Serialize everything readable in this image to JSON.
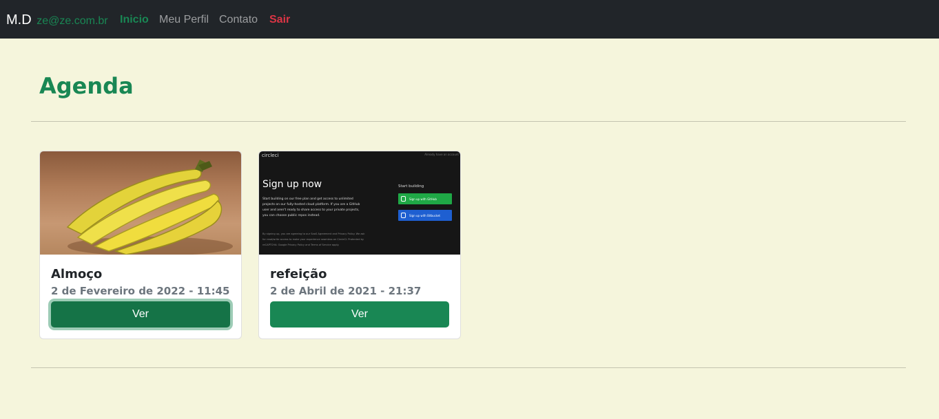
{
  "navbar": {
    "brand": "M.D",
    "email": "ze@ze.com.br",
    "links": [
      "Inicio",
      "Meu Perfil",
      "Contato",
      "Sair"
    ]
  },
  "page": {
    "title": "Agenda"
  },
  "cards": [
    {
      "title": "Almoço",
      "datetime": "2 de Fevereiro de 2022 - 11:45",
      "button": "Ver",
      "image": "banana-photo"
    },
    {
      "title": "refeição",
      "datetime": "2 de Abril de 2021 - 21:37",
      "button": "Ver",
      "image": "signup-screenshot"
    }
  ],
  "signup_image": {
    "logo": "circleci",
    "top_right": "Already have an account",
    "heading": "Sign up now",
    "paragraph": "Start building on our free plan and get access to unlimited projects on our fully-hosted cloud platform. If you are a GitHub user and aren't ready to share access to your private projects, you can choose public repos instead.",
    "fine_print": "By signing up, you are agreeing to our SaaS Agreement and Privacy Policy. We ask for read/write access to make your experience seamless on CircleCI. Protected by reCAPTCHA: Google Privacy Policy and Terms of Service apply.",
    "start_building": "Start building",
    "github_btn": "Sign up with GitHub",
    "bitbucket_btn": "Sign up with Bitbucket"
  },
  "colors": {
    "accent": "#198754",
    "danger": "#dc3545",
    "navbar": "#212529",
    "background": "#f5f5dc"
  }
}
